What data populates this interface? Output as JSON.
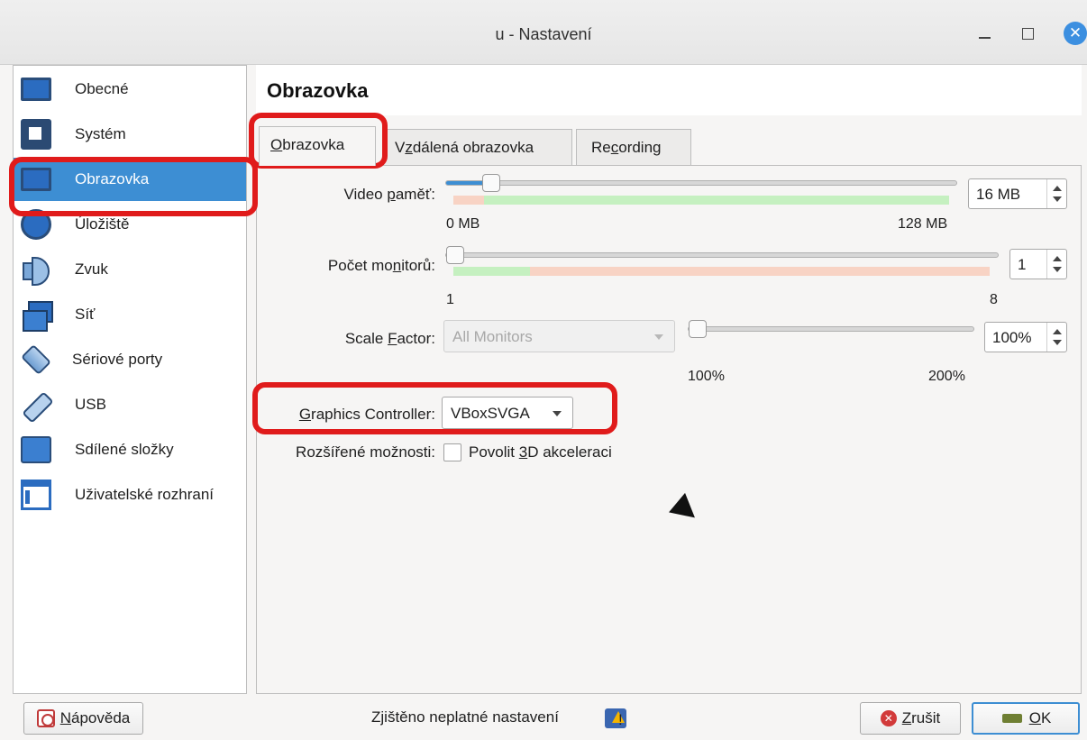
{
  "window": {
    "title": "u - Nastavení",
    "close_glyph": "✕"
  },
  "sidebar": {
    "items": [
      {
        "label": "Obecné",
        "icon": "monitor-icon"
      },
      {
        "label": "Systém",
        "icon": "chip-icon"
      },
      {
        "label": "Obrazovka",
        "icon": "display-icon",
        "selected": true
      },
      {
        "label": "Úložiště",
        "icon": "storage-icon"
      },
      {
        "label": "Zvuk",
        "icon": "speaker-icon"
      },
      {
        "label": "Síť",
        "icon": "network-icon"
      },
      {
        "label": "Sériové porty",
        "icon": "serial-port-icon"
      },
      {
        "label": "USB",
        "icon": "usb-icon"
      },
      {
        "label": "Sdílené složky",
        "icon": "folder-icon"
      },
      {
        "label": "Uživatelské rozhraní",
        "icon": "ui-icon"
      }
    ]
  },
  "main": {
    "title": "Obrazovka",
    "tabs": [
      {
        "pre": "",
        "u": "O",
        "post": "brazovka",
        "selected": true
      },
      {
        "pre": "V",
        "u": "z",
        "post": "dálená obrazovka"
      },
      {
        "pre": "Re",
        "u": "c",
        "post": "ording"
      }
    ],
    "video_memory": {
      "label_pre": "Video ",
      "label_u": "p",
      "label_post": "aměť:",
      "value": "16 MB",
      "min_label": "0 MB",
      "max_label": "128 MB",
      "fraction": 0.125
    },
    "monitor_count": {
      "label_pre": "Počet mo",
      "label_u": "n",
      "label_post": "itorů:",
      "value": "1",
      "min_label": "1",
      "max_label": "8",
      "fraction": 0.0
    },
    "scale_factor": {
      "label_pre": "Scale ",
      "label_u": "F",
      "label_post": "actor:",
      "combo_value": "All Monitors",
      "value": "100%",
      "min_label": "100%",
      "max_label": "200%",
      "fraction": 0.0
    },
    "graphics_controller": {
      "label_pre": "",
      "label_u": "G",
      "label_post": "raphics Controller:",
      "value": "VBoxSVGA"
    },
    "extended": {
      "label": "Rozšířené možnosti:",
      "check_pre": "Povolit ",
      "check_u": "3",
      "check_post": "D akceleraci",
      "checked": false
    }
  },
  "footer": {
    "help_pre": "",
    "help_u": "N",
    "help_post": "ápověda",
    "status": "Zjištěno neplatné nastavení",
    "cancel_pre": "",
    "cancel_u": "Z",
    "cancel_post": "rušit",
    "ok_pre": "",
    "ok_u": "O",
    "ok_post": "K"
  },
  "colors": {
    "accent": "#3d8ed3",
    "highlight": "#e01b1b"
  }
}
